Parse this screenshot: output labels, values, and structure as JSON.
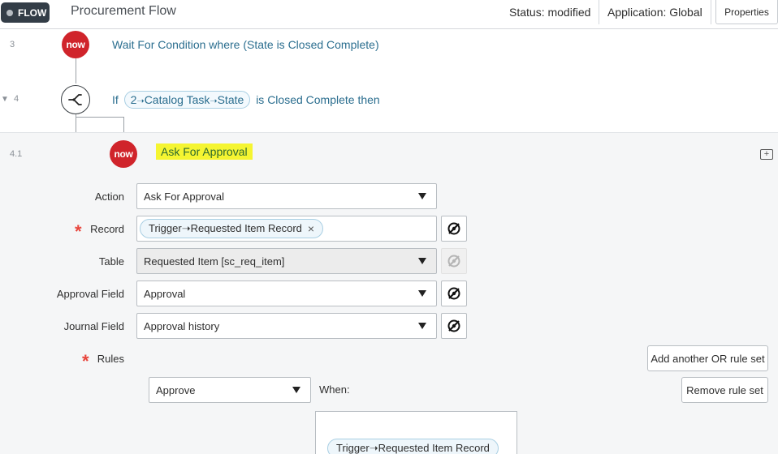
{
  "header": {
    "badge": "FLOW",
    "title": "Procurement Flow",
    "status": "Status: modified",
    "application": "Application: Global",
    "properties_label": "Properties"
  },
  "steps": [
    {
      "number": "3",
      "logo": "now",
      "text": "Wait For Condition where (State is Closed Complete)"
    },
    {
      "number": "4",
      "prefix": "If",
      "pill_parts": [
        "2",
        "Catalog Task",
        "State"
      ],
      "suffix": "is Closed Complete then"
    },
    {
      "number": "4.1",
      "logo": "now",
      "title": "Ask For Approval"
    }
  ],
  "form": {
    "action_label": "Action",
    "action_value": "Ask For Approval",
    "record_label": "Record",
    "record_pill": "Trigger➝Requested Item Record",
    "record_remove": "×",
    "table_label": "Table",
    "table_value": "Requested Item [sc_req_item]",
    "approval_field_label": "Approval Field",
    "approval_field_value": "Approval",
    "journal_field_label": "Journal Field",
    "journal_field_value": "Approval history",
    "rules_label": "Rules",
    "add_or_rule_set": "Add another OR rule set",
    "rule_action_value": "Approve",
    "when_label": "When:",
    "remove_rule_set": "Remove rule set",
    "condition_pill": "Trigger➝Requested Item Record"
  },
  "colors": {
    "now_red": "#d0242b",
    "highlight_yellow": "#f5f531",
    "link_blue": "#2b6e8f",
    "required_red": "#e8453c"
  },
  "icons": {
    "branch": "branch-icon",
    "data_pill_picker": "data-pill-picker-icon",
    "comment": "comment-add-icon",
    "caret": "caret-down-icon"
  }
}
